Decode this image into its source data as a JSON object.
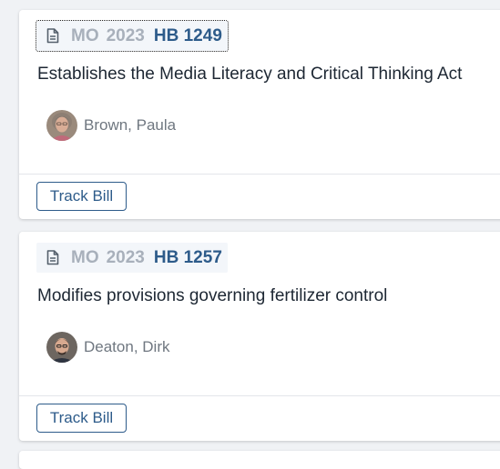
{
  "bills": [
    {
      "state": "MO",
      "year": "2023",
      "number": "HB 1249",
      "title": "Establishes the Media Literacy and Critical Thinking Act",
      "sponsor": "Brown, Paula",
      "action_label": "Track Bill"
    },
    {
      "state": "MO",
      "year": "2023",
      "number": "HB 1257",
      "title": "Modifies provisions governing fertilizer control",
      "sponsor": "Deaton, Dirk",
      "action_label": "Track Bill"
    }
  ],
  "colors": {
    "accent": "#2d5b8a",
    "muted_label": "#a8b0bb",
    "background": "#f0f2f5"
  },
  "icons": {
    "bill": "document-icon"
  }
}
